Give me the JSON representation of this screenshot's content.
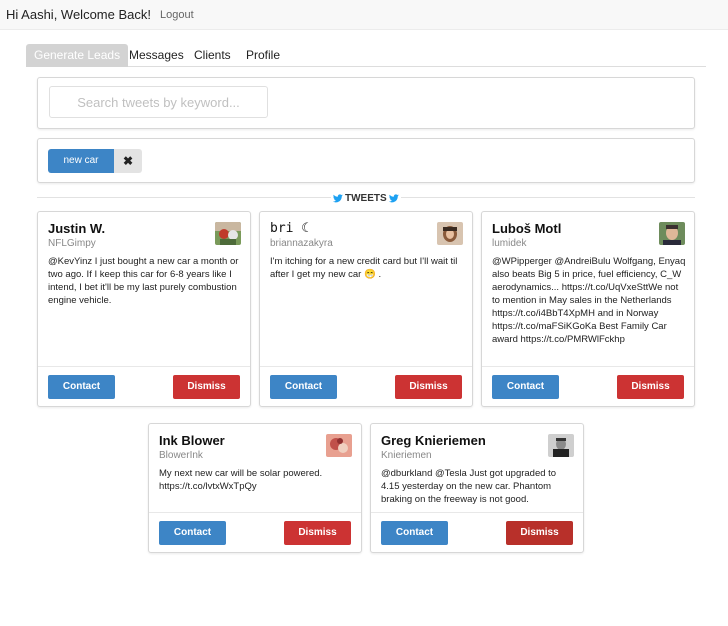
{
  "header": {
    "greeting": "Hi Aashi, Welcome Back!",
    "logout": "Logout"
  },
  "tabs": [
    {
      "label": "Generate Leads",
      "active": true
    },
    {
      "label": "Messages",
      "active": false
    },
    {
      "label": "Clients",
      "active": false
    },
    {
      "label": "Profile",
      "active": false
    }
  ],
  "search": {
    "placeholder": "Search tweets by keyword...",
    "value": ""
  },
  "tags": [
    {
      "label": "new car",
      "remove_icon": "close-icon"
    }
  ],
  "section_title": "TWEETS",
  "buttons": {
    "contact": "Contact",
    "dismiss": "Dismiss"
  },
  "tweets": [
    {
      "name": "Justin W.",
      "handle": "NFLGimpy",
      "text": "@KevYinz I just bought a new car a month or two ago. If I keep this car for 6-8 years like I intend, I bet it'll be my last purely combustion engine vehicle."
    },
    {
      "name": "bri ☾",
      "handle": "briannazakyra",
      "text": "I'm itching for a new credit card but I'll wait til after I get my new car 😁 ."
    },
    {
      "name": "Luboš Motl",
      "handle": "lumidek",
      "text": "@WPipperger @AndreiBulu Wolfgang, Enyaq also beats Big 5 in price, fuel efficiency, C_W aerodynamics... https://t.co/UqVxeSttWe not to mention in May sales in the Netherlands https://t.co/i4BbT4XpMH and in Norway https://t.co/maFSiKGoKa Best Family Car award https://t.co/PMRWlFckhp"
    },
    {
      "name": "Ink Blower",
      "handle": "BlowerInk",
      "text": "My next new car will be solar powered. https://t.co/lvtxWxTpQy"
    },
    {
      "name": "Greg Knieriemen",
      "handle": "Knieriemen",
      "text": "@dburkland @Tesla Just got upgraded to 4.15 yesterday on the new car. Phantom braking on the freeway is not good."
    }
  ],
  "colors": {
    "primary": "#3d85c6",
    "danger": "#cc3333",
    "tab_active_bg": "#d3d3d3",
    "twitter": "#1da1f2"
  }
}
